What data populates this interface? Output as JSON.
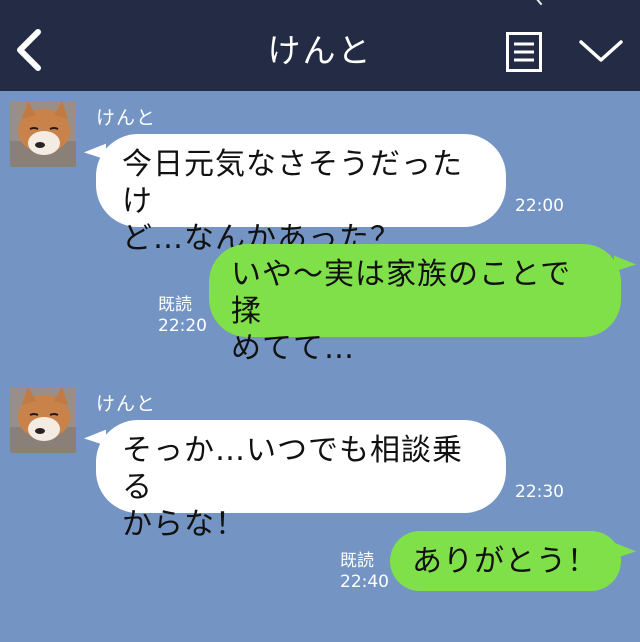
{
  "header": {
    "title": "けんと",
    "back_icon": "chevron-left-icon",
    "menu_icon": "list-icon",
    "collapse_icon": "chevron-down-icon"
  },
  "colors": {
    "header_bg": "#232c44",
    "chat_bg": "#7494c4",
    "incoming_bubble": "#ffffff",
    "outgoing_bubble": "#80e04a"
  },
  "messages": [
    {
      "direction": "in",
      "sender": "けんと",
      "lines": [
        "今日元気なさそうだったけ",
        "ど…なんかあった？"
      ],
      "time": "22:00"
    },
    {
      "direction": "out",
      "lines": [
        "いや〜実は家族のことで揉",
        "めてて…"
      ],
      "read": "既読",
      "time": "22:20"
    },
    {
      "direction": "in",
      "sender": "けんと",
      "lines": [
        "そっか…いつでも相談乗る",
        "からな！"
      ],
      "time": "22:30"
    },
    {
      "direction": "out",
      "lines": [
        "ありがとう！"
      ],
      "read": "既読",
      "time": "22:40"
    }
  ]
}
